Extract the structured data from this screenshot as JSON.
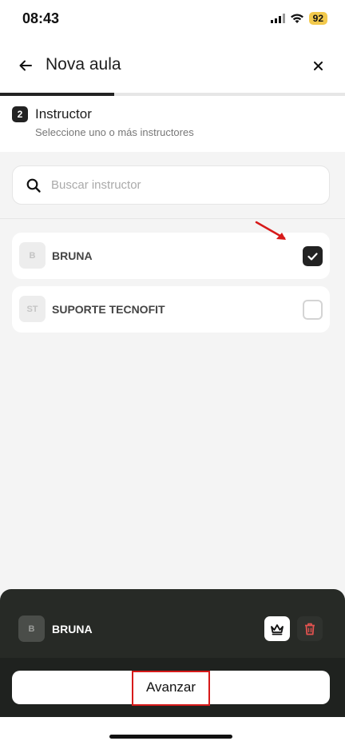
{
  "status_bar": {
    "time": "08:43",
    "battery": "92",
    "icons": [
      "cellular-signal-icon",
      "wifi-icon",
      "battery-icon"
    ]
  },
  "header": {
    "title": "Nova aula",
    "back_icon": "arrow-left-icon",
    "close_icon": "close-icon"
  },
  "progress": {
    "fraction": 0.33
  },
  "step": {
    "number": "2",
    "title": "Instructor",
    "subtitle": "Seleccione uno o más instructores"
  },
  "search": {
    "placeholder": "Buscar instructor",
    "value": "",
    "icon": "search-icon"
  },
  "instructors": [
    {
      "initials": "B",
      "name": "BRUNA",
      "checked": true
    },
    {
      "initials": "ST",
      "name": "SUPORTE TECNOFIT",
      "checked": false
    }
  ],
  "selected": {
    "initials": "B",
    "name": "BRUNA",
    "crown_icon": "crown-icon",
    "trash_icon": "trash-icon"
  },
  "footer": {
    "advance_label": "Avanzar"
  },
  "colors": {
    "dark": "#222222",
    "sheet": "#272a26",
    "footer": "#1f221f",
    "annotation_red": "#d71a1a",
    "trash_red": "#e0524f",
    "battery_yellow": "#f2c94c"
  }
}
